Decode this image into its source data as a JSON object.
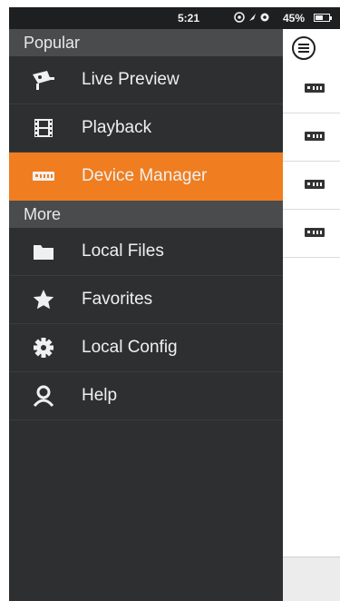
{
  "status_bar": {
    "time": "5:21",
    "battery_percent": "45%"
  },
  "drawer": {
    "sections": [
      {
        "title": "Popular",
        "items": [
          {
            "label": "Live Preview",
            "icon": "camera-icon"
          },
          {
            "label": "Playback",
            "icon": "film-icon"
          },
          {
            "label": "Device Manager",
            "icon": "dvr-icon",
            "active": true
          }
        ]
      },
      {
        "title": "More",
        "items": [
          {
            "label": "Local Files",
            "icon": "folder-icon"
          },
          {
            "label": "Favorites",
            "icon": "star-icon"
          },
          {
            "label": "Local Config",
            "icon": "gear-icon"
          },
          {
            "label": "Help",
            "icon": "user-icon"
          }
        ]
      }
    ]
  },
  "content": {
    "menu_icon": "hamburger-icon",
    "device_icon": "dvr-icon",
    "device_rows": 4
  },
  "colors": {
    "accent": "#f07d1f",
    "drawer_bg": "#2e2f31",
    "section_bg": "#4a4b4d"
  }
}
